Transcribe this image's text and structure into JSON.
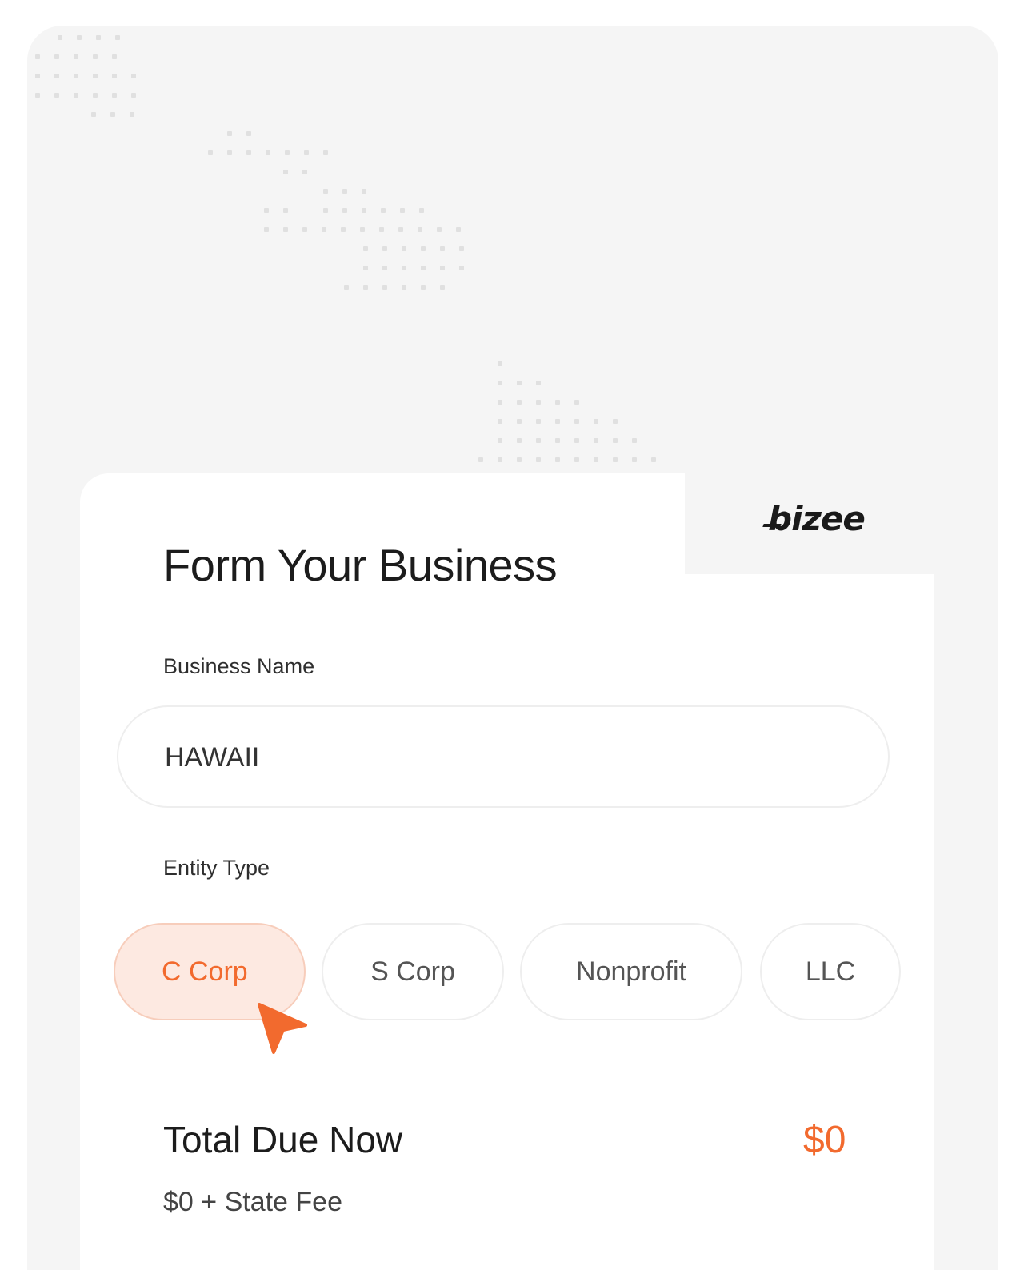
{
  "brand": {
    "logo_text": "bizee",
    "accent_color": "#f26a2e"
  },
  "form": {
    "title": "Form Your Business",
    "business_name": {
      "label": "Business Name",
      "value": "HAWAII"
    },
    "entity_type": {
      "label": "Entity Type",
      "options": [
        "C Corp",
        "S Corp",
        "Nonprofit",
        "LLC"
      ],
      "selected": "C Corp"
    }
  },
  "summary": {
    "total_label": "Total Due Now",
    "total_value": "$0",
    "fee_note": "$0 + State Fee"
  },
  "icons": {
    "cursor": "pointer-cursor-icon"
  }
}
